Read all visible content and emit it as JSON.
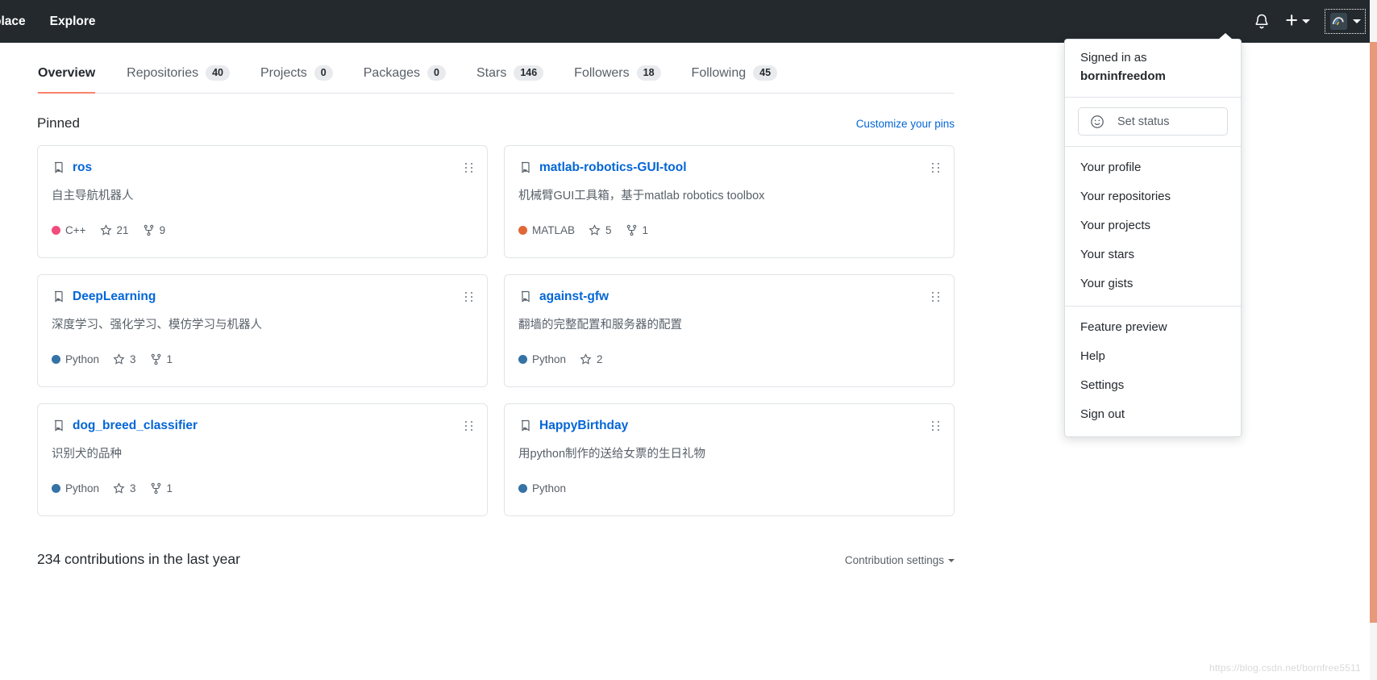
{
  "header": {
    "nav": [
      {
        "label": "place",
        "name": "nav-marketplace"
      },
      {
        "label": "Explore",
        "name": "nav-explore"
      }
    ],
    "icons": {
      "notifications": "bell-icon",
      "create_new": "plus-icon",
      "avatar": "avatar-icon"
    }
  },
  "dropdown": {
    "signed_in_as": "Signed in as",
    "username": "borninfreedom",
    "status_placeholder": "Set status",
    "status_icon": "smiley-icon",
    "groups": [
      {
        "items": [
          {
            "label": "Your profile",
            "name": "menu-your-profile"
          },
          {
            "label": "Your repositories",
            "name": "menu-your-repositories"
          },
          {
            "label": "Your projects",
            "name": "menu-your-projects"
          },
          {
            "label": "Your stars",
            "name": "menu-your-stars"
          },
          {
            "label": "Your gists",
            "name": "menu-your-gists"
          }
        ]
      },
      {
        "items": [
          {
            "label": "Feature preview",
            "name": "menu-feature-preview"
          },
          {
            "label": "Help",
            "name": "menu-help"
          },
          {
            "label": "Settings",
            "name": "menu-settings"
          },
          {
            "label": "Sign out",
            "name": "menu-sign-out"
          }
        ]
      }
    ]
  },
  "tabs": [
    {
      "label": "Overview",
      "count": null,
      "active": true,
      "name": "tab-overview"
    },
    {
      "label": "Repositories",
      "count": "40",
      "active": false,
      "name": "tab-repositories"
    },
    {
      "label": "Projects",
      "count": "0",
      "active": false,
      "name": "tab-projects"
    },
    {
      "label": "Packages",
      "count": "0",
      "active": false,
      "name": "tab-packages"
    },
    {
      "label": "Stars",
      "count": "146",
      "active": false,
      "name": "tab-stars"
    },
    {
      "label": "Followers",
      "count": "18",
      "active": false,
      "name": "tab-followers"
    },
    {
      "label": "Following",
      "count": "45",
      "active": false,
      "name": "tab-following"
    }
  ],
  "pinned": {
    "title": "Pinned",
    "customize_label": "Customize your pins",
    "repos": [
      {
        "name": "ros",
        "description": "自主导航机器人",
        "language": "C++",
        "language_color": "#f34b7d",
        "stars": "21",
        "forks": "9"
      },
      {
        "name": "matlab-robotics-GUI-tool",
        "description": "机械臂GUI工具箱，基于matlab robotics toolbox",
        "language": "MATLAB",
        "language_color": "#e16737",
        "stars": "5",
        "forks": "1"
      },
      {
        "name": "DeepLearning",
        "description": "深度学习、强化学习、模仿学习与机器人",
        "language": "Python",
        "language_color": "#3572A5",
        "stars": "3",
        "forks": "1"
      },
      {
        "name": "against-gfw",
        "description": "翻墙的完整配置和服务器的配置",
        "language": "Python",
        "language_color": "#3572A5",
        "stars": "2",
        "forks": null
      },
      {
        "name": "dog_breed_classifier",
        "description": "识别犬的品种",
        "language": "Python",
        "language_color": "#3572A5",
        "stars": "3",
        "forks": "1"
      },
      {
        "name": "HappyBirthday",
        "description": "用python制作的送给女票的生日礼物",
        "language": "Python",
        "language_color": "#3572A5",
        "stars": null,
        "forks": null
      }
    ]
  },
  "contributions": {
    "title": "234 contributions in the last year",
    "settings_label": "Contribution settings"
  },
  "watermark": "https://blog.csdn.net/bornfree5511"
}
